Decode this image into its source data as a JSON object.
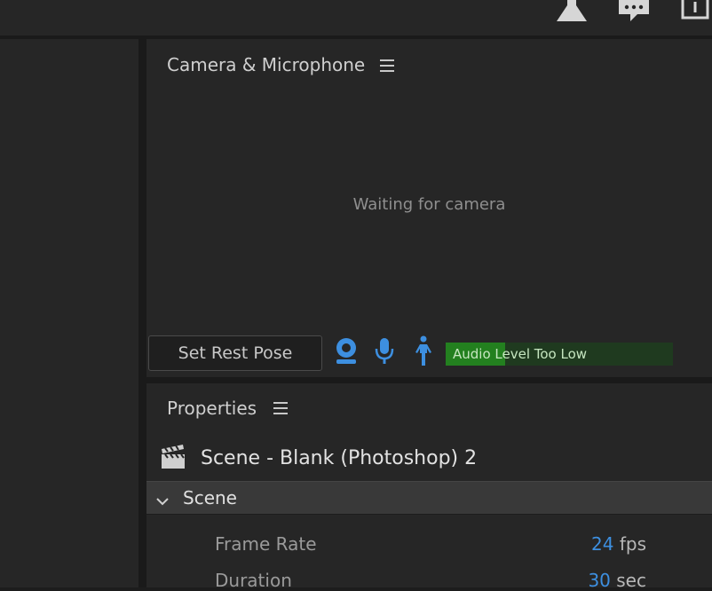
{
  "top_toolbar": {
    "icons": [
      "flask-icon",
      "chat-icon",
      "share-icon"
    ]
  },
  "camera_panel": {
    "title": "Camera & Microphone",
    "status": "Waiting for camera",
    "set_rest_pose_label": "Set Rest Pose",
    "controls": [
      "webcam-icon",
      "microphone-icon",
      "body-tracking-icon"
    ],
    "audio_meter": {
      "label": "Audio Level Too Low",
      "level": 0.26
    }
  },
  "properties_panel": {
    "title": "Properties",
    "scene_name": "Scene - Blank (Photoshop) 2",
    "section": {
      "label": "Scene",
      "rows": [
        {
          "label": "Frame Rate",
          "value": "24",
          "unit": "fps"
        },
        {
          "label": "Duration",
          "value": "30",
          "unit": "sec"
        }
      ]
    }
  },
  "colors": {
    "accent_blue": "#3d8fe0",
    "audio_green": "#23801f",
    "panel_bg": "#262626"
  }
}
